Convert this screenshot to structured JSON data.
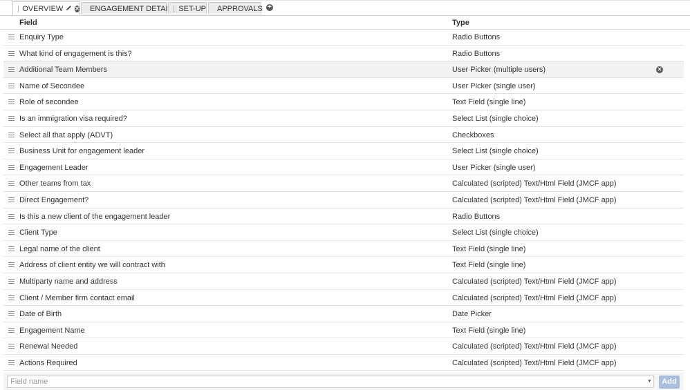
{
  "tabs": [
    {
      "label": "OVERVIEW",
      "active": true
    },
    {
      "label": "ENGAGEMENT DETAILS",
      "active": false
    },
    {
      "label": "SET-UP",
      "active": false
    },
    {
      "label": "APPROVALS",
      "active": false
    }
  ],
  "tab_icons": {
    "edit": "pencil-icon",
    "remove": "close-icon",
    "add": "plus-icon"
  },
  "table": {
    "headers": {
      "field": "Field",
      "type": "Type"
    },
    "rows": [
      {
        "field": "Enquiry Type",
        "type": "Radio Buttons"
      },
      {
        "field": "What kind of engagement is this?",
        "type": "Radio Buttons"
      },
      {
        "field": "Additional Team Members",
        "type": "User Picker (multiple users)"
      },
      {
        "field": "Name of Secondee",
        "type": "User Picker (single user)"
      },
      {
        "field": "Role of secondee",
        "type": "Text Field (single line)"
      },
      {
        "field": "Is an immigration visa required?",
        "type": "Select List (single choice)"
      },
      {
        "field": "Select all that apply (ADVT)",
        "type": "Checkboxes"
      },
      {
        "field": "Business Unit for engagement leader",
        "type": "Select List (single choice)"
      },
      {
        "field": "Engagement Leader",
        "type": "User Picker (single user)"
      },
      {
        "field": "Other teams from tax",
        "type": "Calculated (scripted) Text/Html Field (JMCF app)"
      },
      {
        "field": "Direct Engagement?",
        "type": "Calculated (scripted) Text/Html Field (JMCF app)"
      },
      {
        "field": "Is this a new client of the engagement leader",
        "type": "Radio Buttons"
      },
      {
        "field": "Client Type",
        "type": "Select List (single choice)"
      },
      {
        "field": "Legal name of the client",
        "type": "Text Field (single line)"
      },
      {
        "field": "Address of client entity we will contract with",
        "type": "Text Field (single line)"
      },
      {
        "field": "Multiparty name and address",
        "type": "Calculated (scripted) Text/Html Field (JMCF app)"
      },
      {
        "field": "Client / Member firm contact email",
        "type": "Calculated (scripted) Text/Html Field (JMCF app)"
      },
      {
        "field": "Date of Birth",
        "type": "Date Picker"
      },
      {
        "field": "Engagement Name",
        "type": "Text Field (single line)"
      },
      {
        "field": "Renewal Needed",
        "type": "Calculated (scripted) Text/Html Field (JMCF app)"
      },
      {
        "field": "Actions Required",
        "type": "Calculated (scripted) Text/Html Field (JMCF app)"
      }
    ],
    "hovered_row_index": 2
  },
  "footer": {
    "field_placeholder": "Field name",
    "add_label": "Add"
  },
  "colors": {
    "add_button": "#a7bfdf",
    "row_highlight": "#f2f2f2",
    "tab_inactive": "#ebebeb"
  }
}
